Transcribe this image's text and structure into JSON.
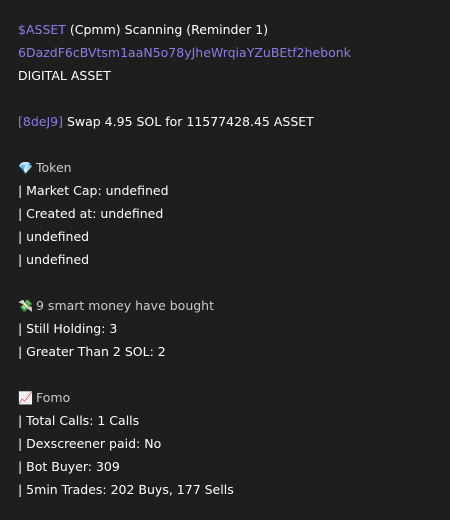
{
  "header": {
    "ticker": "$ASSET",
    "title_rest": " (Cpmm) Scanning (Reminder 1)",
    "contract_address": "6DazdF6cBVtsm1aaN5o78yJheWrqiaYZuBEtf2hebonk",
    "name": "DIGITAL ASSET"
  },
  "swap": {
    "tx_id": "[8deJ9]",
    "text": " Swap 4.95 SOL for 11577428.45 ASSET"
  },
  "token": {
    "icon": "gem-icon",
    "glyph": "💎",
    "title": "Token",
    "lines": [
      "| Market Cap: undefined",
      "| Created at: undefined",
      "| undefined",
      "| undefined"
    ]
  },
  "smart_money": {
    "icon": "money-wings-icon",
    "glyph": "💸",
    "title": "9 smart money have bought",
    "lines": [
      "| Still Holding: 3",
      "| Greater Than 2 SOL: 2"
    ]
  },
  "fomo": {
    "icon": "chart-increasing-icon",
    "glyph": "📈",
    "title": "Fomo",
    "lines": [
      "| Total Calls: 1 Calls",
      "| Dexscreener paid: No",
      "| Bot Buyer: 309",
      "| 5min Trades: 202 Buys, 177 Sells"
    ]
  },
  "colors": {
    "background": "#1e1e1e",
    "link": "#8a7ee8",
    "text": "#ffffff"
  }
}
